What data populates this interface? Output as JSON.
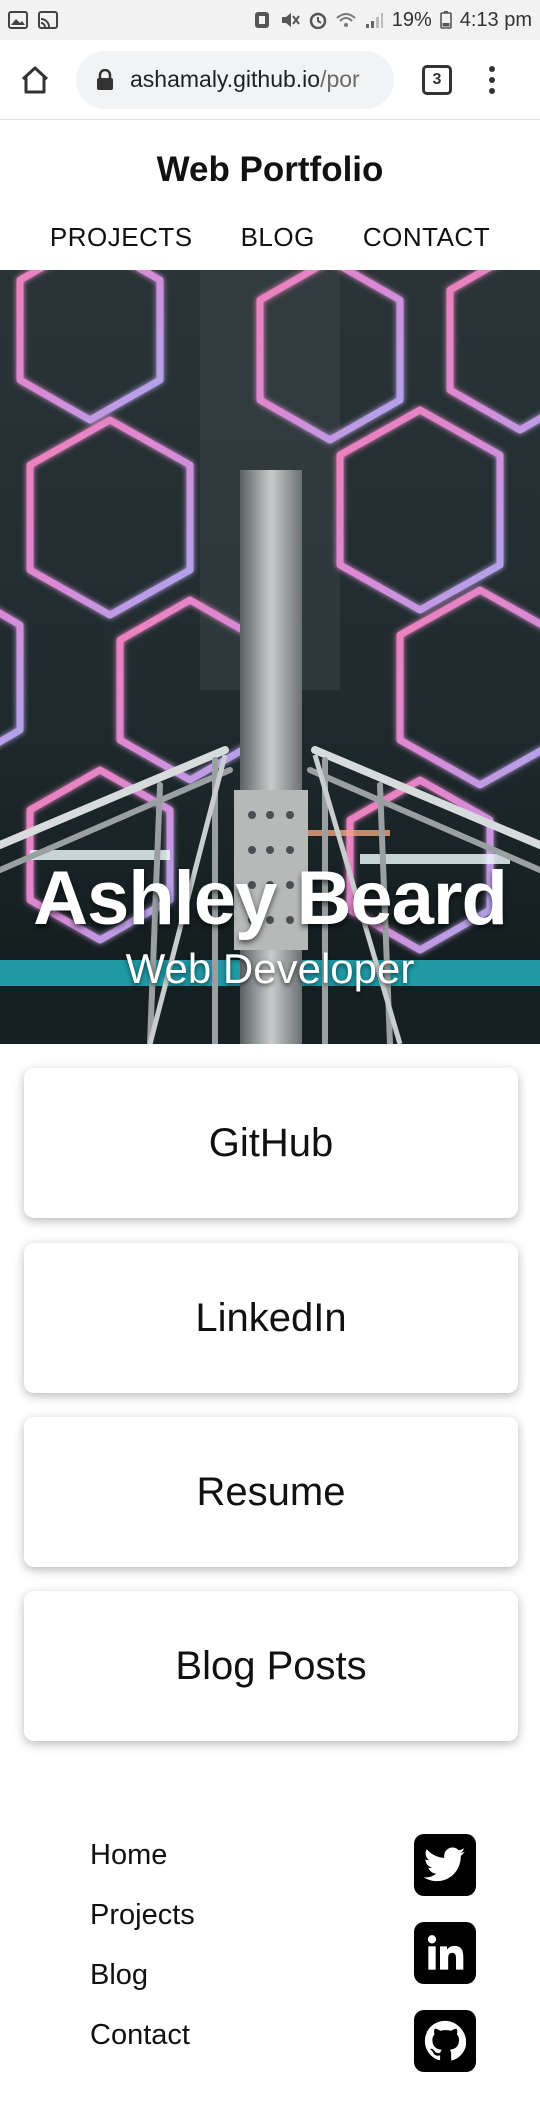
{
  "status_bar": {
    "battery": "19%",
    "time": "4:13 pm"
  },
  "browser": {
    "url_main": "ashamaly.github.io",
    "url_rest": "/por",
    "tab_count": "3"
  },
  "site": {
    "title": "Web Portfolio",
    "nav": [
      "PROJECTS",
      "BLOG",
      "CONTACT"
    ]
  },
  "hero": {
    "name": "Ashley Beard",
    "role": "Web Developer"
  },
  "cards": [
    "GitHub",
    "LinkedIn",
    "Resume",
    "Blog Posts"
  ],
  "footer": {
    "links": [
      "Home",
      "Projects",
      "Blog",
      "Contact"
    ],
    "social_icons": [
      "twitter-icon",
      "linkedin-icon",
      "github-icon"
    ]
  },
  "colors": {
    "hero_bg": "#1e2a2c",
    "neon_pink": "#e07ac0",
    "neon_violet": "#b59ae6",
    "teal_stripe": "#1f9aa6"
  }
}
